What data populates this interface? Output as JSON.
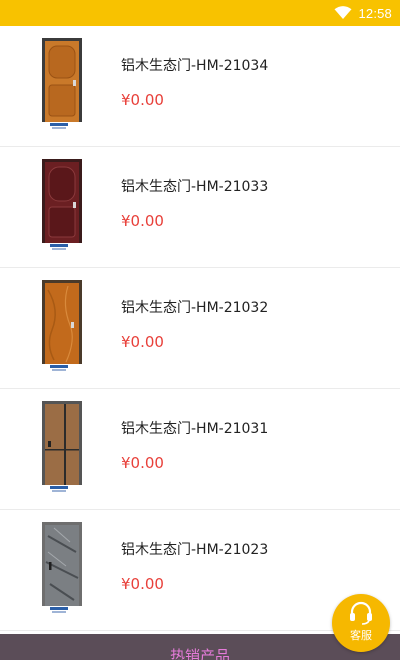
{
  "status_bar": {
    "time": "12:58",
    "icons": [
      "wifi-icon"
    ],
    "color": "#f8c200"
  },
  "products": [
    {
      "name": "铝木生态门-HM-21034",
      "price": "¥0.00",
      "image": "door-oak-panel"
    },
    {
      "name": "铝木生态门-HM-21033",
      "price": "¥0.00",
      "image": "door-maroon-panel"
    },
    {
      "name": "铝木生态门-HM-21032",
      "price": "¥0.00",
      "image": "door-orange-wood"
    },
    {
      "name": "铝木生态门-HM-21031",
      "price": "¥0.00",
      "image": "door-walnut-stripe"
    },
    {
      "name": "铝木生态门-HM-21023",
      "price": "¥0.00",
      "image": "door-grey-marble"
    }
  ],
  "bottom_bar": {
    "label": "热销产品"
  },
  "service_button": {
    "label": "客服",
    "icon": "headset-icon"
  },
  "colors": {
    "price": "#e8403a",
    "accent": "#f6b800",
    "bottom_bar_bg": "#5b4d58",
    "bottom_bar_text": "#e57bd9"
  }
}
